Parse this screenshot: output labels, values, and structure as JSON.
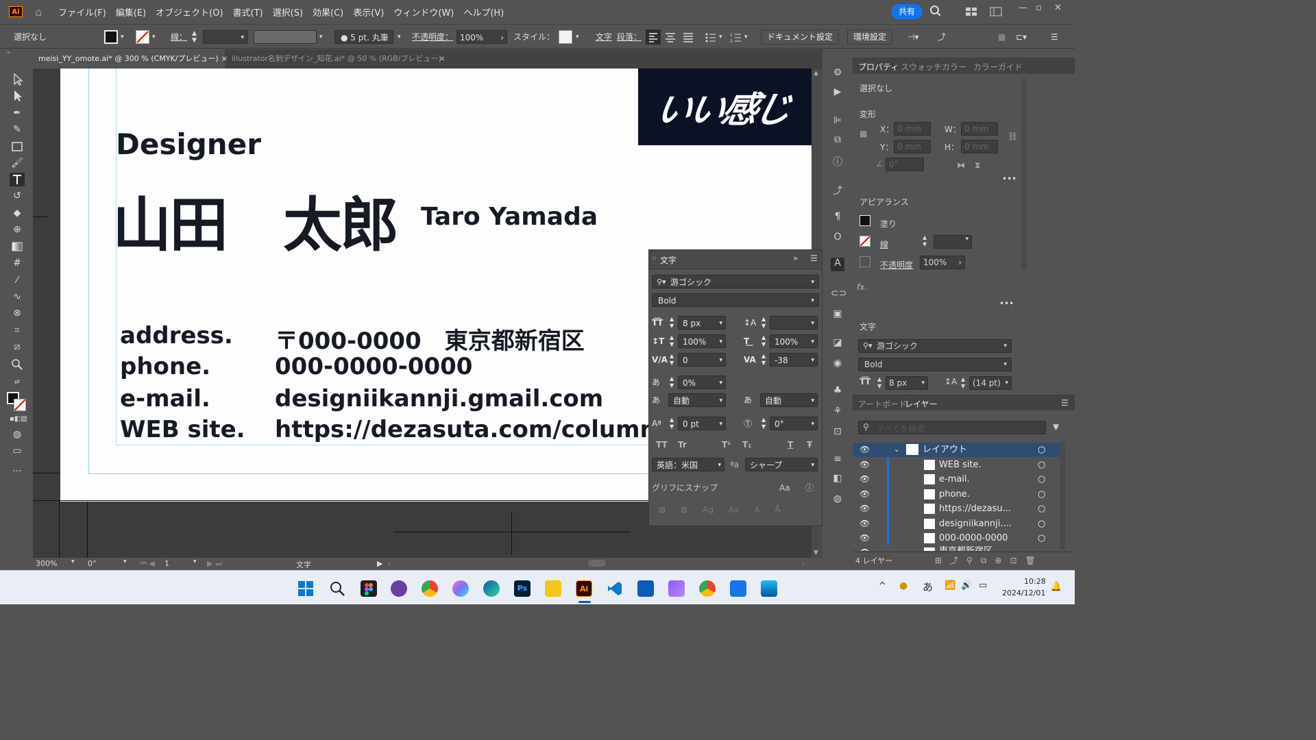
{
  "app": {
    "logo": "Ai",
    "share": "共有"
  },
  "menus": [
    "ファイル(F)",
    "編集(E)",
    "オブジェクト(O)",
    "書式(T)",
    "選択(S)",
    "効果(C)",
    "表示(V)",
    "ウィンドウ(W)",
    "ヘルプ(H)"
  ],
  "control": {
    "selection": "選択なし",
    "stroke_label": "線：",
    "brush": "5 pt. 丸筆",
    "opacity_label": "不透明度：",
    "opacity_value": "100%",
    "style_label": "スタイル：",
    "char_link": "文字",
    "para_link": "段落：",
    "doc_settings": "ドキュメント設定",
    "preferences": "環境設定"
  },
  "tabs": [
    {
      "label": "meisi_YY_omote.ai* @ 300 % (CMYK/プレビュー)",
      "close": "×"
    },
    {
      "label": "illustrator名刺デザイン_知花.ai* @ 50 % (RGB/プレビュー)",
      "close": "×"
    }
  ],
  "card": {
    "title": "Designer",
    "name_jp": "山田　太郎",
    "name_en": "Taro Yamada",
    "logo_text": "いい感じ",
    "labels": [
      "address.",
      "phone.",
      "e-mail.",
      "WEB site."
    ],
    "values": [
      "〒000-0000　東京都新宿区",
      "000-0000-0000",
      "designiikannji.gmail.com",
      "https://dezasuta.com/columns"
    ]
  },
  "char_panel": {
    "title": "文字",
    "font": "游ゴシック",
    "style": "Bold",
    "size": "8 px",
    "leading": "",
    "vscale": "100%",
    "hscale": "100%",
    "kerning": "0",
    "tracking": "-38",
    "tsume": "0%",
    "aki_left": "自動",
    "aki_right": "自動",
    "baseline": "0 pt",
    "rotation": "0°",
    "language": "英語：米国",
    "aa_label": "ªa",
    "antialias": "シャープ",
    "snap_label": "グリフにスナップ",
    "caps": [
      "TT",
      "Tr",
      "T¹",
      "T₁",
      "T",
      "Ŧ"
    ]
  },
  "props": {
    "tabs": [
      "プロパティ",
      "スウォッチ",
      "カラー",
      "カラーガイド"
    ],
    "selection": "選択なし",
    "transform_title": "変形",
    "x_label": "X：",
    "y_label": "Y：",
    "w_label": "W：",
    "h_label": "H：",
    "x_val": "0 mm",
    "y_val": "0 mm",
    "w_val": "0 mm",
    "h_val": "0 mm",
    "angle": "0°",
    "appearance_title": "アピアランス",
    "fill_label": "塗り",
    "stroke_label": "線",
    "opacity_label": "不透明度",
    "opacity_value": "100%",
    "fx": "fx.",
    "type_title": "文字",
    "font": "游ゴシック",
    "style": "Bold",
    "size": "8 px",
    "leading": "(14 pt)"
  },
  "layers": {
    "tabs": [
      "アートボード",
      "レイヤー"
    ],
    "search_placeholder": "すべてを検索",
    "parent": "レイアウト",
    "items": [
      "WEB site.",
      "e-mail.",
      "phone.",
      "https://dezasu...",
      "designiikannji....",
      "000-0000-0000",
      "東京都新宿区"
    ],
    "count": "4 レイヤー"
  },
  "status": {
    "zoom": "300%",
    "angle": "0°",
    "artboard": "1",
    "tool": "文字"
  },
  "taskbar": {
    "ime": "あ",
    "time": "10:28",
    "date": "2024/12/01"
  },
  "colors": {
    "accent": "#1473e6",
    "card_text": "#161a24",
    "logo_bg": "#0c1226",
    "guide": "#55c6e6"
  }
}
